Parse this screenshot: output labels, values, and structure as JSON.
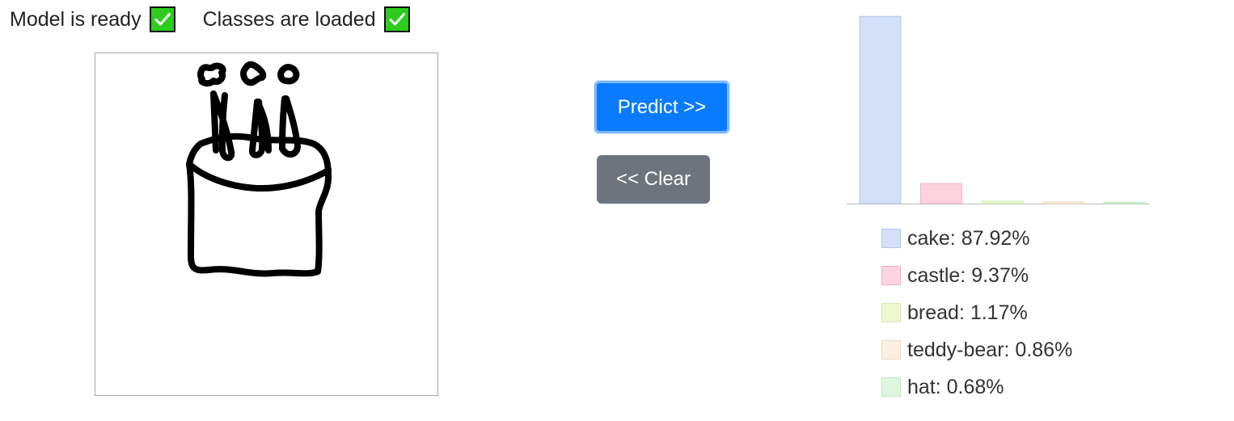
{
  "status": {
    "model_label": "Model is ready",
    "classes_label": "Classes are loaded",
    "check_color": "#2ecc1f"
  },
  "buttons": {
    "predict_label": "Predict >>",
    "clear_label": "<< Clear"
  },
  "colors": {
    "predict_bg": "#0a7bff",
    "clear_bg": "#6c757d"
  },
  "canvas": {
    "drawing": "cake with three candles"
  },
  "predictions": [
    {
      "label": "cake",
      "value": 87.92,
      "text": "cake: 87.92%",
      "fill": "#d3e0f8",
      "stroke": "#b5c9ee"
    },
    {
      "label": "castle",
      "value": 9.37,
      "text": "castle: 9.37%",
      "fill": "#fdd3e0",
      "stroke": "#f2b3c6"
    },
    {
      "label": "bread",
      "value": 1.17,
      "text": "bread: 1.17%",
      "fill": "#eaf9d2",
      "stroke": "#d3eab4"
    },
    {
      "label": "teddy-bear",
      "value": 0.86,
      "text": "teddy-bear: 0.86%",
      "fill": "#fcefdf",
      "stroke": "#eedcc2"
    },
    {
      "label": "hat",
      "value": 0.68,
      "text": "hat: 0.68%",
      "fill": "#def6e0",
      "stroke": "#c2e6c5"
    }
  ],
  "chart_data": {
    "type": "bar",
    "categories": [
      "cake",
      "castle",
      "bread",
      "teddy-bear",
      "hat"
    ],
    "values": [
      87.92,
      9.37,
      1.17,
      0.86,
      0.68
    ],
    "title": "",
    "xlabel": "",
    "ylabel": "",
    "ylim": [
      0,
      88
    ],
    "grid": false,
    "legend": "below"
  }
}
